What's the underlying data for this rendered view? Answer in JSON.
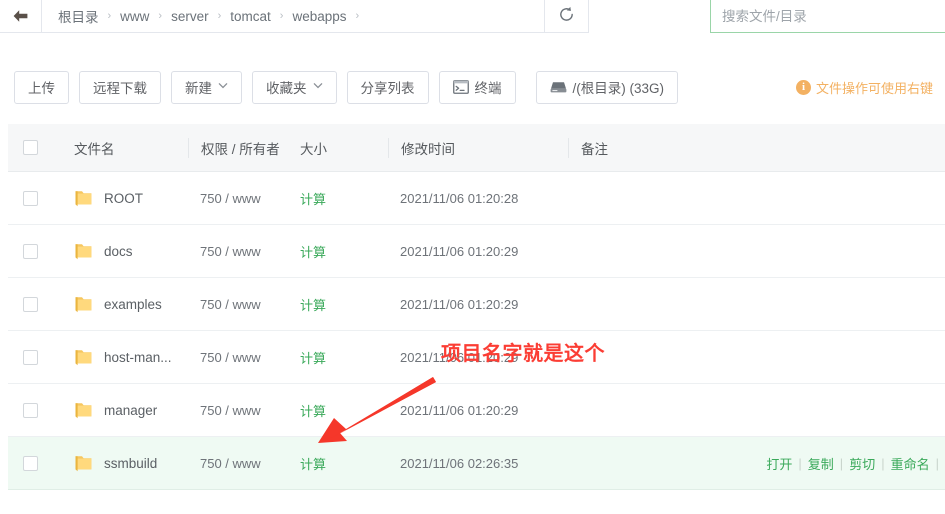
{
  "pathbar": {
    "back_icon": "arrow-left-icon",
    "refresh_icon": "refresh-icon",
    "crumbs": [
      "根目录",
      "www",
      "server",
      "tomcat",
      "webapps"
    ],
    "separator": "›",
    "trailing_separator": "›"
  },
  "search": {
    "placeholder": "搜索文件/目录",
    "value": "",
    "border_color": "#9ad5a8"
  },
  "toolbar": {
    "upload_label": "上传",
    "remote_download_label": "远程下载",
    "new_label": "新建",
    "favorites_label": "收藏夹",
    "share_list_label": "分享列表",
    "terminal_label": "终端",
    "terminal_icon": "terminal-icon",
    "disk_label": "/(根目录) (33G)",
    "disk_icon": "hard-drive-icon",
    "caret_icon": "chevron-down-icon",
    "tip_icon": "info-icon",
    "tip_text": "文件操作可使用右键",
    "tip_color": "#f3b162"
  },
  "table": {
    "columns": [
      "文件名",
      "权限 / 所有者",
      "大小",
      "修改时间",
      "备注"
    ],
    "select_all_icon": "checkbox-icon",
    "size_action_label": "计算",
    "folder_icon": "folder-icon",
    "rows": [
      {
        "name": "ROOT",
        "perm": "750 / www",
        "size": "计算",
        "time": "2021/11/06 01:20:28",
        "note": "",
        "highlighted": false
      },
      {
        "name": "docs",
        "perm": "750 / www",
        "size": "计算",
        "time": "2021/11/06 01:20:29",
        "note": "",
        "highlighted": false
      },
      {
        "name": "examples",
        "perm": "750 / www",
        "size": "计算",
        "time": "2021/11/06 01:20:29",
        "note": "",
        "highlighted": false
      },
      {
        "name": "host-man...",
        "perm": "750 / www",
        "size": "计算",
        "time": "2021/11/06 01:20:29",
        "note": "",
        "highlighted": false
      },
      {
        "name": "manager",
        "perm": "750 / www",
        "size": "计算",
        "time": "2021/11/06 01:20:29",
        "note": "",
        "highlighted": false
      },
      {
        "name": "ssmbuild",
        "perm": "750 / www",
        "size": "计算",
        "time": "2021/11/06 02:26:35",
        "note": "",
        "highlighted": true
      }
    ],
    "row_actions": {
      "open": "打开",
      "copy": "复制",
      "cut": "剪切",
      "rename": "重命名",
      "separator": "|"
    }
  },
  "annotations": {
    "text": "项目名字就是这个",
    "color": "#fb3d34",
    "arrow_icon": "arrow-pointer-icon"
  }
}
